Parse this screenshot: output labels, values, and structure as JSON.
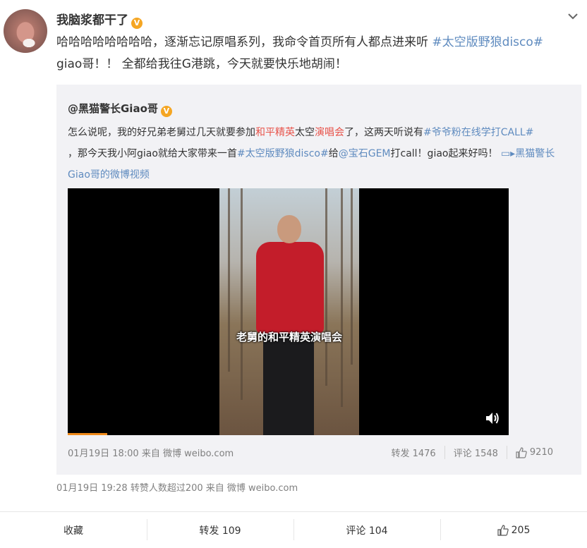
{
  "post": {
    "author": "我脑浆都干了",
    "text_plain_1": "哈哈哈哈哈哈哈哈，逐渐忘记原唱系列，我命令首页所有人都点进来听 ",
    "topic": "#太空版野狼disco#",
    "text_plain_2": "giao哥！！ 全都给我往G港跳，今天就要快乐地胡闹！",
    "meta": "01月19日 19:28 转赞人数超过200  来自 微博 weibo.com"
  },
  "repost": {
    "author": "@黑猫警长Giao哥",
    "t1": "怎么说呢，我的好兄弟老舅过几天就要参加",
    "t_red1": "和平精英",
    "t2": "太空",
    "t_red2": "演唱会",
    "t3": "了，这两天听说有",
    "topic1": "#爷爷粉在线学打CALL#",
    "t4": "，那今天我小阿giao就给大家带来一首",
    "topic2": "#太空版野狼disco#",
    "t5": "给",
    "mention": "@宝石GEM",
    "t6": "打call！giao起来好吗！",
    "video_link": "黑猫警长Giao哥的微博视频",
    "video_subtitle": "老舅的和平精英演唱会",
    "meta": "01月19日 18:00 来自 微博 weibo.com",
    "repost_label": "转发 1476",
    "comment_label": "评论 1548",
    "like_count": "9210",
    "video_progress": 0.09
  },
  "footer": {
    "favorite": "收藏",
    "repost": "转发 109",
    "comment": "评论 104",
    "like": "205"
  },
  "colors": {
    "link": "#5f8bbf",
    "topic": "#eb7350",
    "highlight": "#e8534a",
    "repost_bg": "#f2f2f5",
    "badge": "#f5a623"
  }
}
